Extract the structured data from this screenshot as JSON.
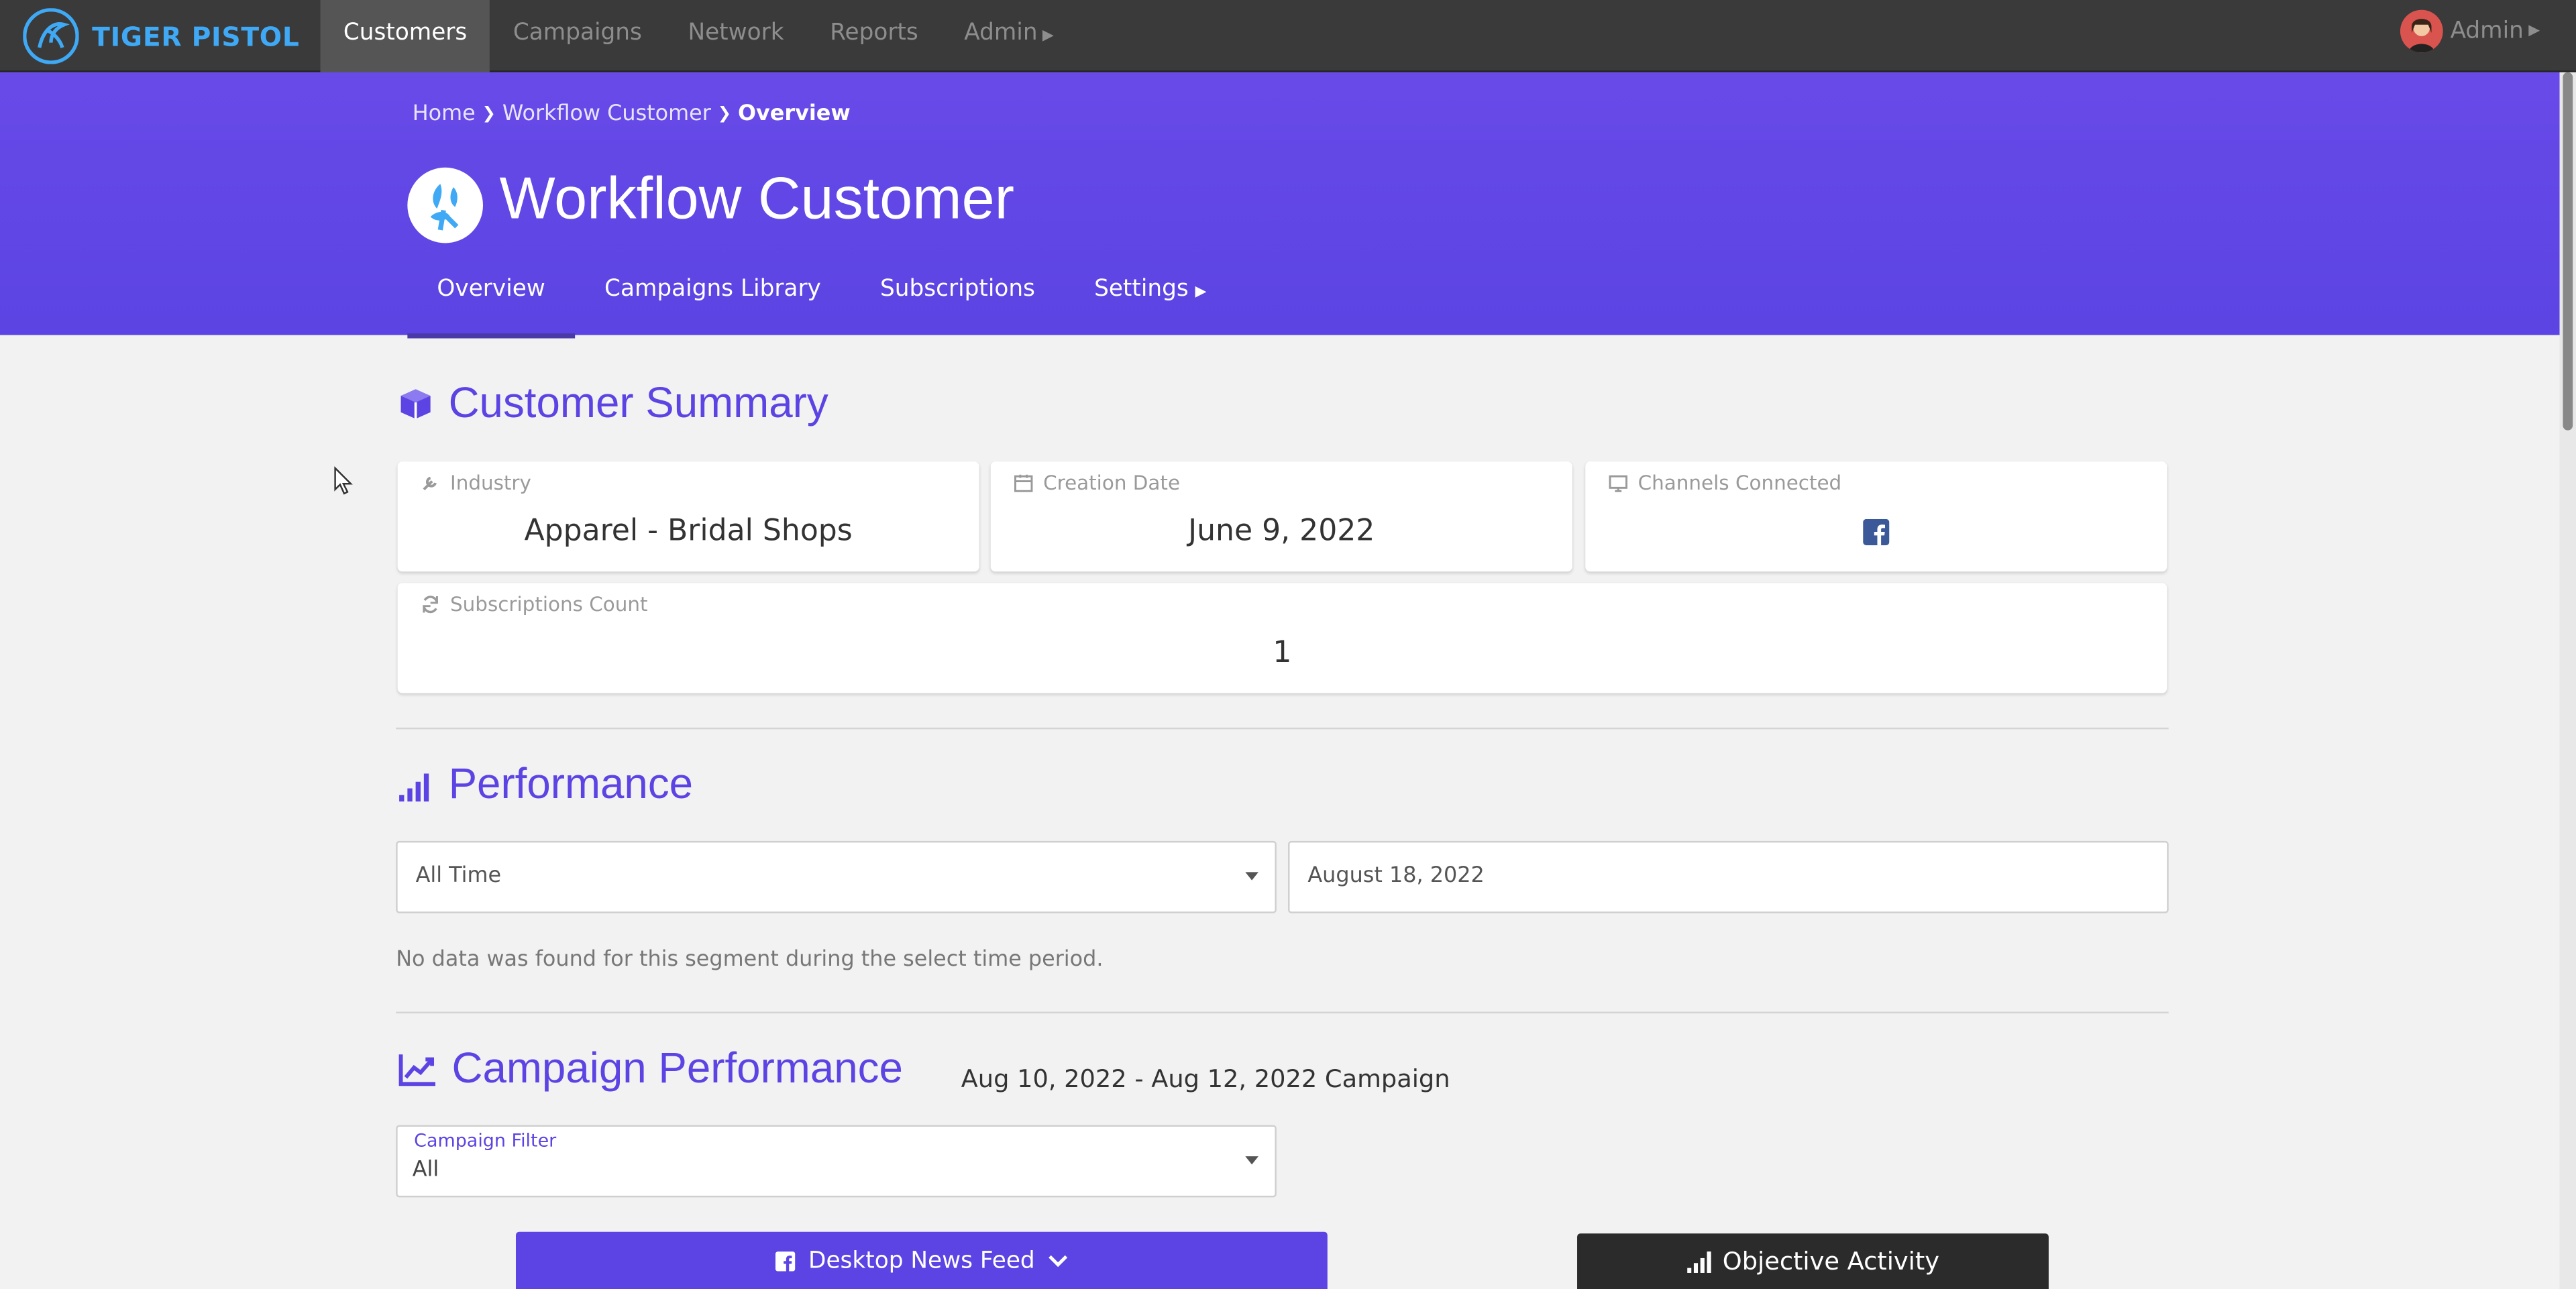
{
  "brand": {
    "name": "TIGER PISTOL"
  },
  "nav": {
    "items": [
      {
        "label": "Customers"
      },
      {
        "label": "Campaigns"
      },
      {
        "label": "Network"
      },
      {
        "label": "Reports"
      },
      {
        "label": "Admin"
      }
    ],
    "user_label": "Admin"
  },
  "breadcrumb": {
    "home": "Home",
    "parent": "Workflow Customer",
    "current": "Overview"
  },
  "customer": {
    "name": "Workflow Customer"
  },
  "subnav": {
    "overview": "Overview",
    "library": "Campaigns Library",
    "subscriptions": "Subscriptions",
    "settings": "Settings"
  },
  "summary": {
    "title": "Customer Summary",
    "industry_label": "Industry",
    "industry_value": "Apparel - Bridal Shops",
    "creation_label": "Creation Date",
    "creation_value": "June 9, 2022",
    "channels_label": "Channels Connected",
    "subs_label": "Subscriptions Count",
    "subs_value": "1"
  },
  "performance": {
    "title": "Performance",
    "period_value": "All Time",
    "date_value": "August 18, 2022",
    "empty_note": "No data was found for this segment during the select time period."
  },
  "campaign_performance": {
    "title": "Campaign Performance",
    "range": "Aug 10, 2022 - Aug 12, 2022 Campaign",
    "filter_label": "Campaign Filter",
    "filter_value": "All",
    "feed_button": "Desktop News Feed",
    "objective_label": "Objective Activity"
  },
  "colors": {
    "accent": "#5b44e3",
    "topbar": "#3a3a3a",
    "brand": "#3fa9f5"
  }
}
